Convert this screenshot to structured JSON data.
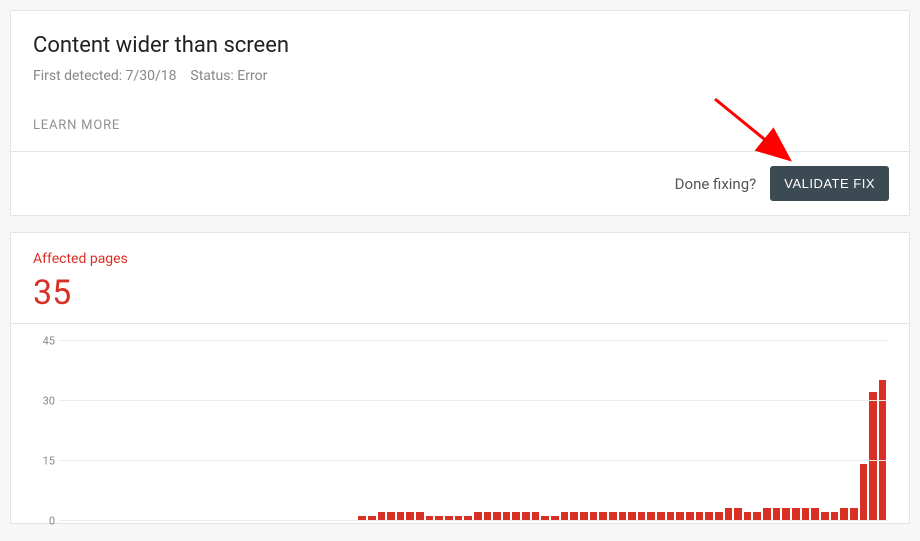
{
  "issue": {
    "title": "Content wider than screen",
    "first_detected_label": "First detected:",
    "first_detected_value": "7/30/18",
    "status_label": "Status:",
    "status_value": "Error",
    "learn_more": "LEARN MORE",
    "done_fixing": "Done fixing?",
    "validate_fix": "VALIDATE FIX"
  },
  "affected": {
    "label": "Affected pages",
    "count": "35"
  },
  "chart_data": {
    "type": "bar",
    "ylabel": "",
    "ylim": [
      0,
      45
    ],
    "yticks": [
      0,
      15,
      30,
      45
    ],
    "values": [
      0,
      0,
      0,
      0,
      0,
      0,
      0,
      0,
      0,
      0,
      0,
      0,
      0,
      0,
      0,
      0,
      0,
      0,
      0,
      0,
      0,
      0,
      0,
      0,
      0,
      0,
      0,
      0,
      0,
      0,
      1,
      1,
      2,
      2,
      2,
      2,
      2,
      1,
      1,
      1,
      1,
      1,
      2,
      2,
      2,
      2,
      2,
      2,
      2,
      1,
      1,
      2,
      2,
      2,
      2,
      2,
      2,
      2,
      2,
      2,
      2,
      2,
      2,
      2,
      2,
      2,
      2,
      2,
      3,
      3,
      2,
      2,
      3,
      3,
      3,
      3,
      3,
      3,
      2,
      2,
      3,
      3,
      14,
      32,
      35
    ]
  },
  "annotation": {
    "arrow_to": "validate-fix-button"
  }
}
